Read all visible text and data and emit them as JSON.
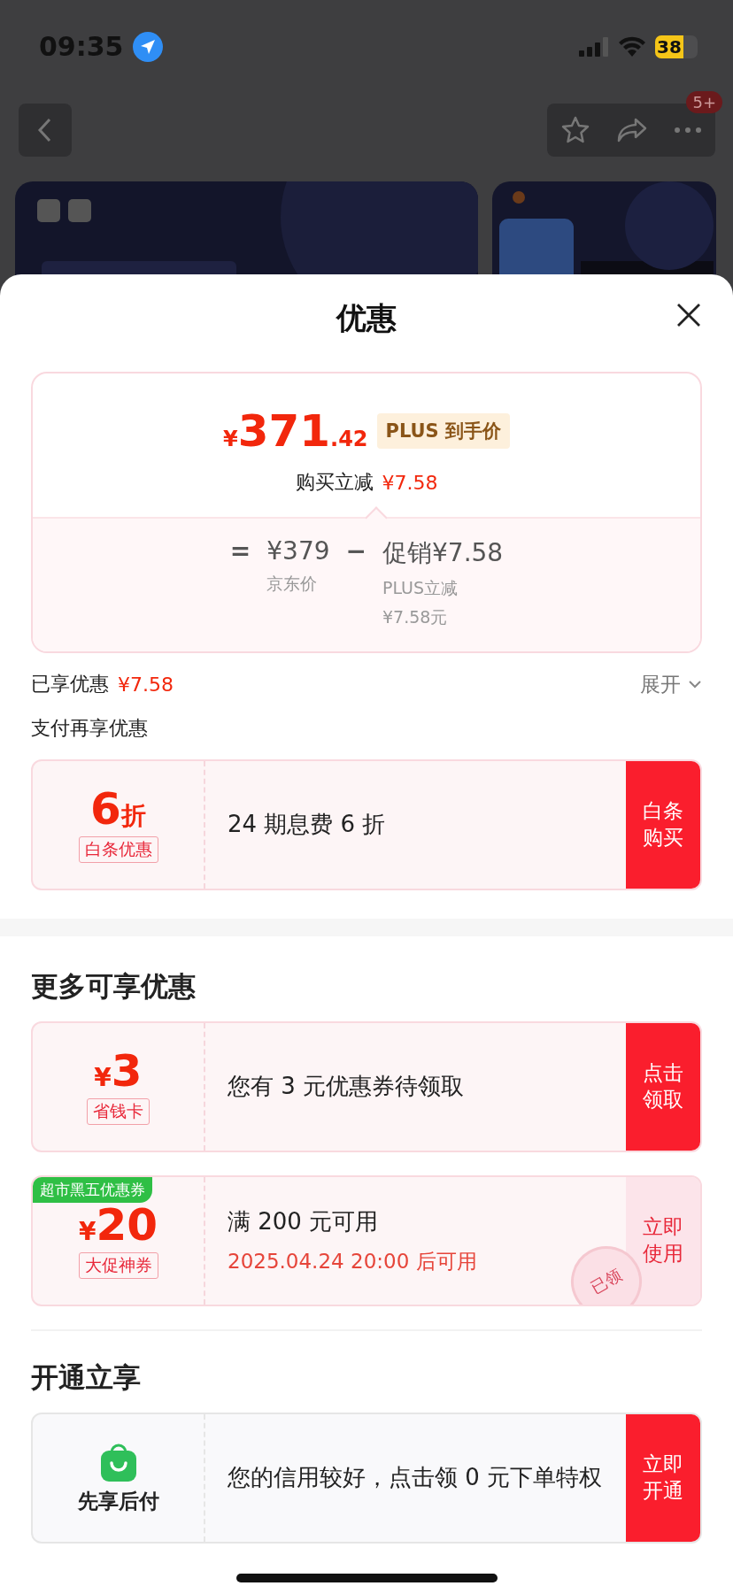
{
  "status_bar": {
    "time": "09:35",
    "battery": "38"
  },
  "nav": {
    "badge": "5+"
  },
  "sheet": {
    "title": "优惠"
  },
  "price_card": {
    "currency": "¥",
    "integer": "371",
    "decimal": ".42",
    "tag": "PLUS 到手价",
    "reduce_label": "购买立减",
    "reduce_amount": "¥7.58",
    "breakdown": [
      {
        "kind": "op",
        "text": "="
      },
      {
        "kind": "term",
        "text": "¥379",
        "notes": [
          "京东价"
        ]
      },
      {
        "kind": "op",
        "text": "−"
      },
      {
        "kind": "term",
        "text": "促销¥7.58",
        "notes": [
          "PLUS立减",
          "¥7.58元"
        ]
      }
    ]
  },
  "enjoyed": {
    "label": "已享优惠",
    "amount": "¥7.58",
    "expand": "展开",
    "expanded": false
  },
  "sections": [
    {
      "title": "支付再享优惠",
      "kind": "plain",
      "coupons": [
        {
          "kind": "value",
          "value": "6",
          "unit": "折",
          "tag": "白条优惠",
          "desc": "24 期息费 6 折",
          "action": "白条购买"
        }
      ]
    },
    {
      "title": "更多可享优惠",
      "kind": "bold",
      "coupons": [
        {
          "kind": "value",
          "currency": "¥",
          "value": "3",
          "tag": "省钱卡",
          "desc": "您有 3 元优惠券待领取",
          "action": "点击领取"
        },
        {
          "kind": "value",
          "corner": "超市黑五优惠券",
          "currency": "¥",
          "value": "20",
          "tag": "大促神券",
          "desc": "满 200 元可用",
          "note": "2025.04.24 20:00 后可用",
          "action": "立即使用",
          "stamp": "已领"
        }
      ]
    },
    {
      "title": "开通立享",
      "kind": "bold",
      "coupons": [
        {
          "kind": "icon",
          "label": "先享后付",
          "desc": "您的信用较好，点击领 0 元下单特权",
          "action": "立即开通"
        }
      ]
    }
  ]
}
